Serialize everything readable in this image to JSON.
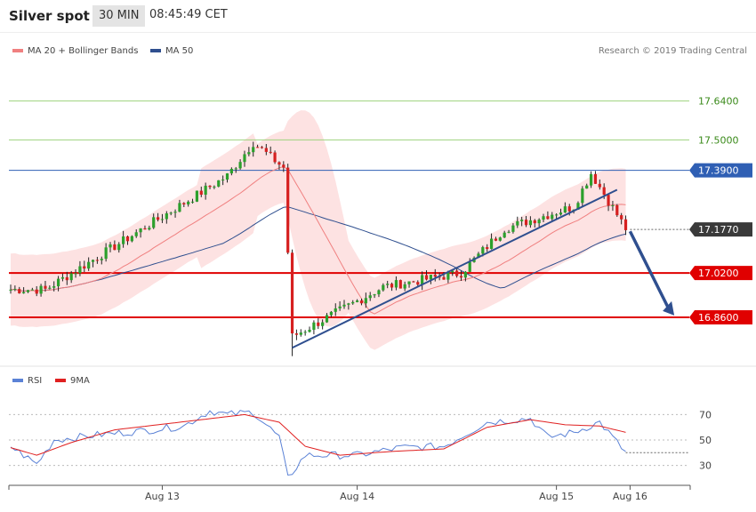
{
  "header": {
    "instrument": "Silver spot",
    "timeframe": "30 MIN",
    "time": "08:45:49 CET"
  },
  "legend": {
    "ma20": {
      "label": "MA 20 + Bollinger Bands",
      "color": "#f08080"
    },
    "ma50": {
      "label": "MA 50",
      "color": "#2f4f8f"
    }
  },
  "credit": "Research © 2019 Trading Central",
  "rsi_legend": {
    "rsi": {
      "label": "RSI",
      "color": "#5b82d6"
    },
    "ma9": {
      "label": "9MA",
      "color": "#e02020"
    }
  },
  "colors": {
    "up": "#2ca02c",
    "down": "#d62020",
    "band": "#fde2e2",
    "resistance": "#e00000",
    "green_level": "#9ed27e",
    "blue_level": "#2f5fb4",
    "trend": "#2f4f8f"
  },
  "chart_data": [
    {
      "type": "candlestick",
      "title": "Silver spot",
      "ylim": [
        16.69,
        17.78
      ],
      "y_labels": [
        "17.6400",
        "17.5000",
        "17.3900",
        "17.1770",
        "17.0200",
        "16.8600"
      ],
      "x_ticks": [
        "Aug 13",
        "Aug 14",
        "Aug 15",
        "Aug 16"
      ],
      "levels": [
        {
          "value": 17.64,
          "label": "17.6400",
          "kind": "green"
        },
        {
          "value": 17.5,
          "label": "17.5000",
          "kind": "green"
        },
        {
          "value": 17.39,
          "label": "17.3900",
          "kind": "resistance_blue"
        },
        {
          "value": 17.177,
          "label": "17.1770",
          "kind": "last_price"
        },
        {
          "value": 17.02,
          "label": "17.0200",
          "kind": "support_red"
        },
        {
          "value": 16.86,
          "label": "16.8600",
          "kind": "support_red"
        }
      ],
      "key_points": [
        {
          "t": 8,
          "price": 16.96
        },
        {
          "t": 50,
          "price": 17.37
        },
        {
          "t": 56,
          "price": 17.49
        },
        {
          "t": 63,
          "price": 17.4
        },
        {
          "t": 65,
          "price": 16.79
        },
        {
          "t": 86,
          "price": 16.97
        },
        {
          "t": 104,
          "price": 17.02
        },
        {
          "t": 114,
          "price": 17.18
        },
        {
          "t": 130,
          "price": 17.26
        },
        {
          "t": 134,
          "price": 17.38
        },
        {
          "t": 142,
          "price": 17.18
        }
      ],
      "trendline": {
        "from": {
          "t": 65,
          "price": 16.75
        },
        "to": {
          "t": 140,
          "price": 17.32
        }
      },
      "projection": {
        "from": {
          "t": 143,
          "price": 17.17
        },
        "to": {
          "t": 153,
          "price": 16.87
        }
      },
      "bollinger_half_width": 0.13
    },
    {
      "type": "line",
      "title": "RSI",
      "ylim": [
        15,
        85
      ],
      "y_ticks": [
        70,
        50,
        30
      ],
      "series": [
        {
          "name": "RSI",
          "key_points": [
            {
              "t": 0,
              "v": 45
            },
            {
              "t": 6,
              "v": 31
            },
            {
              "t": 10,
              "v": 50
            },
            {
              "t": 20,
              "v": 54
            },
            {
              "t": 30,
              "v": 57
            },
            {
              "t": 40,
              "v": 61
            },
            {
              "t": 46,
              "v": 73
            },
            {
              "t": 50,
              "v": 70
            },
            {
              "t": 56,
              "v": 72
            },
            {
              "t": 62,
              "v": 52
            },
            {
              "t": 64,
              "v": 20
            },
            {
              "t": 68,
              "v": 38
            },
            {
              "t": 80,
              "v": 38
            },
            {
              "t": 90,
              "v": 44
            },
            {
              "t": 100,
              "v": 45
            },
            {
              "t": 110,
              "v": 64
            },
            {
              "t": 120,
              "v": 67
            },
            {
              "t": 124,
              "v": 52
            },
            {
              "t": 130,
              "v": 56
            },
            {
              "t": 136,
              "v": 64
            },
            {
              "t": 142,
              "v": 40
            }
          ]
        },
        {
          "name": "9MA",
          "key_points": [
            {
              "t": 0,
              "v": 44
            },
            {
              "t": 6,
              "v": 38
            },
            {
              "t": 14,
              "v": 48
            },
            {
              "t": 24,
              "v": 58
            },
            {
              "t": 34,
              "v": 62
            },
            {
              "t": 44,
              "v": 66
            },
            {
              "t": 54,
              "v": 70
            },
            {
              "t": 62,
              "v": 64
            },
            {
              "t": 68,
              "v": 45
            },
            {
              "t": 76,
              "v": 38
            },
            {
              "t": 88,
              "v": 41
            },
            {
              "t": 100,
              "v": 43
            },
            {
              "t": 110,
              "v": 60
            },
            {
              "t": 120,
              "v": 66
            },
            {
              "t": 128,
              "v": 62
            },
            {
              "t": 136,
              "v": 61
            },
            {
              "t": 142,
              "v": 56
            }
          ]
        }
      ]
    }
  ]
}
